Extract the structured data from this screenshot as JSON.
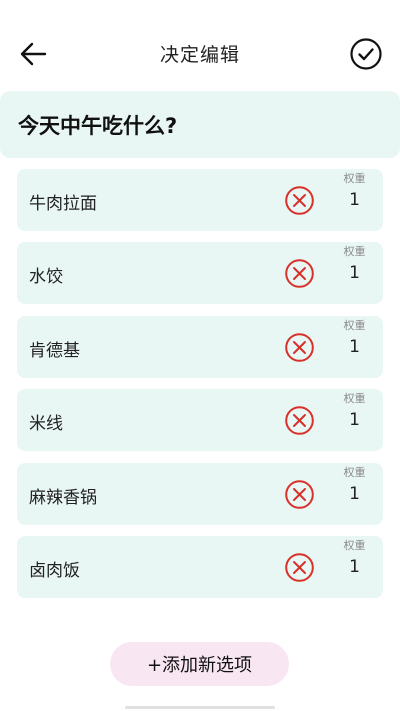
{
  "header": {
    "title": "决定编辑",
    "back_icon": "arrow-left-icon",
    "confirm_icon": "check-circle-icon"
  },
  "question": {
    "text": "今天中午吃什么?"
  },
  "weight_label": "权重",
  "options": [
    {
      "label": "牛肉拉面",
      "weight": "1"
    },
    {
      "label": "水饺",
      "weight": "1"
    },
    {
      "label": "肯德基",
      "weight": "1"
    },
    {
      "label": "米线",
      "weight": "1"
    },
    {
      "label": "麻辣香锅",
      "weight": "1"
    },
    {
      "label": "卤肉饭",
      "weight": "1"
    }
  ],
  "add_button": {
    "label": "+添加新选项"
  },
  "colors": {
    "card_background": "#e9f7f4",
    "delete_red": "#d8302a",
    "add_button_background": "#f8e6f3"
  }
}
